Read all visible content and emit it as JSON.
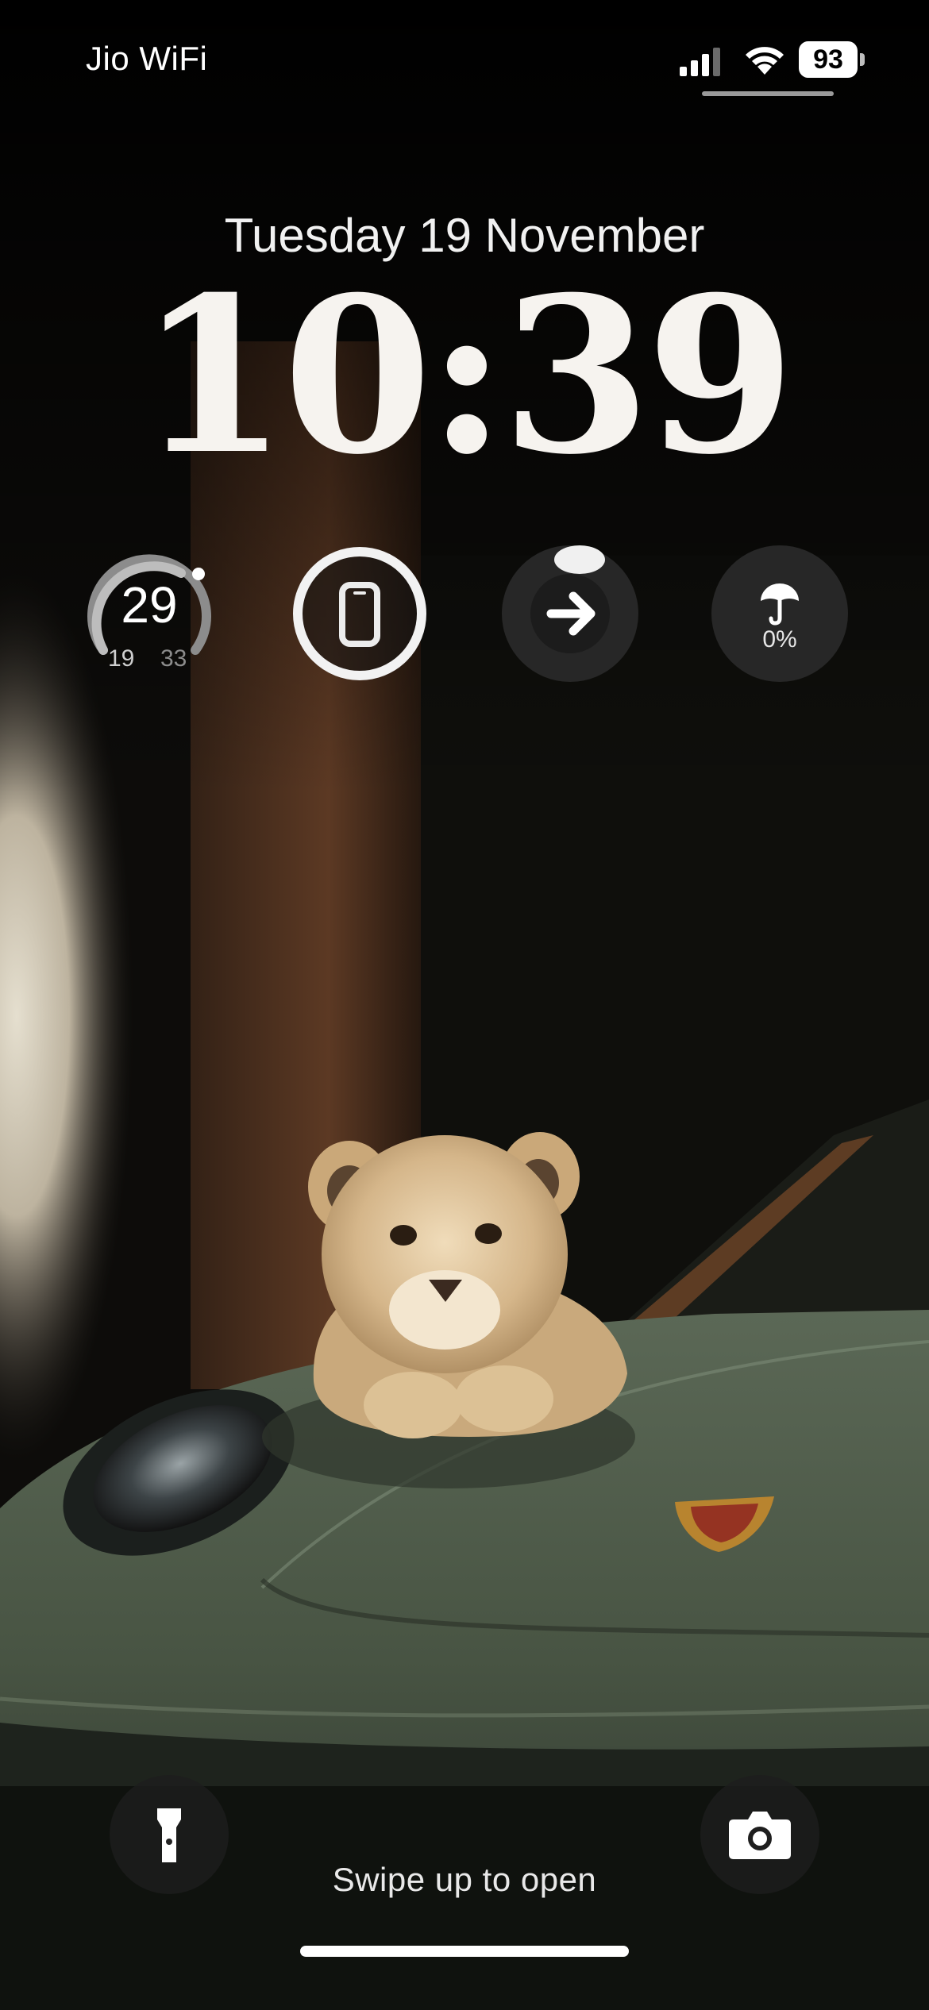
{
  "status_bar": {
    "carrier": "Jio WiFi",
    "battery_percent": "93",
    "signal_bars_active": 3,
    "icons": [
      "signal-icon",
      "wifi-icon",
      "battery-icon"
    ]
  },
  "lock_screen": {
    "date": "Tuesday 19 November",
    "time": "10:39"
  },
  "widgets": {
    "weather": {
      "current_temp": "29",
      "low": "19",
      "high": "33",
      "icon": "temperature-gauge-icon"
    },
    "device_battery": {
      "icon": "iphone-icon",
      "ring_fraction": 1.0
    },
    "arrow_widget": {
      "icon": "arrow-right-icon"
    },
    "rain": {
      "icon": "umbrella-icon",
      "value": "0%"
    }
  },
  "bottom": {
    "flashlight_icon": "flashlight-icon",
    "camera_icon": "camera-icon",
    "hint": "Swipe up to open"
  },
  "colors": {
    "wallpaper_car": "#4c5a48",
    "wallpaper_wall": "#d9d2c0",
    "wallpaper_wood": "#5a3a24",
    "lion_fur": "#d6b98f"
  }
}
